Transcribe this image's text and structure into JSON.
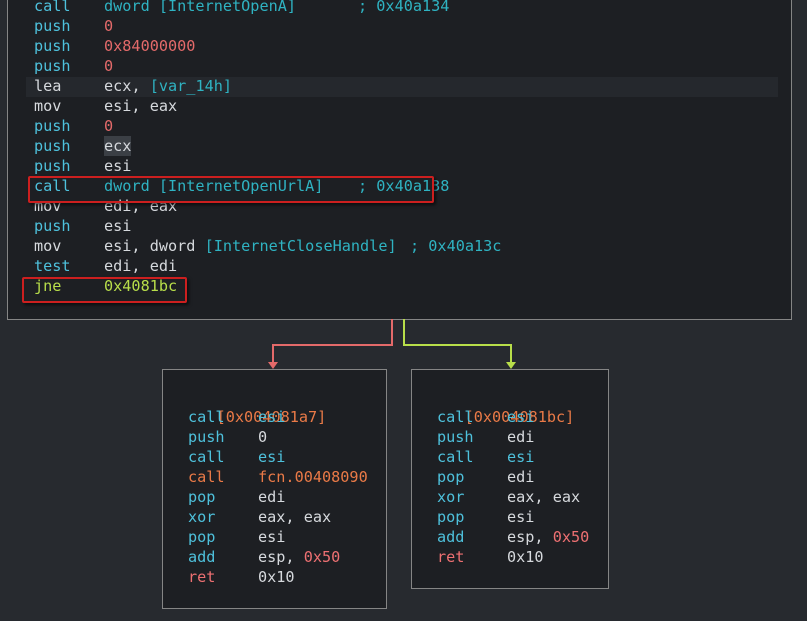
{
  "main_block": {
    "lines": [
      {
        "mnemonic": "call",
        "operand": "dword [InternetOpenA]",
        "comment": "; 0x40a134"
      },
      {
        "mnemonic": "push",
        "operand": "0"
      },
      {
        "mnemonic": "push",
        "operand": "0x84000000"
      },
      {
        "mnemonic": "push",
        "operand": "0"
      },
      {
        "mnemonic": "lea",
        "operand_reg": "ecx",
        "operand_rest": ", ",
        "operand_var": "[var_14h]"
      },
      {
        "mnemonic": "mov",
        "operand": "esi, eax"
      },
      {
        "mnemonic": "push",
        "operand": "0"
      },
      {
        "mnemonic": "push",
        "operand": "ecx"
      },
      {
        "mnemonic": "push",
        "operand": "esi"
      },
      {
        "mnemonic": "call",
        "operand": "dword [InternetOpenUrlA]",
        "comment": "; 0x40a138"
      },
      {
        "mnemonic": "mov",
        "operand": "edi, eax"
      },
      {
        "mnemonic": "push",
        "operand": "esi"
      },
      {
        "mnemonic": "mov",
        "operand_reg": "esi, dword ",
        "operand_var": "[InternetCloseHandle]",
        "comment": "; 0x40a13c"
      },
      {
        "mnemonic": "test",
        "operand": "edi, edi"
      },
      {
        "mnemonic": "jne",
        "operand": "0x4081bc"
      }
    ]
  },
  "left_block": {
    "address": "[0x004081a7]",
    "lines": [
      {
        "mnemonic": "call",
        "operand": "esi"
      },
      {
        "mnemonic": "push",
        "operand": "0"
      },
      {
        "mnemonic": "call",
        "operand": "esi"
      },
      {
        "mnemonic": "call",
        "operand": "fcn.00408090"
      },
      {
        "mnemonic": "pop",
        "operand": "edi"
      },
      {
        "mnemonic": "xor",
        "operand": "eax, eax"
      },
      {
        "mnemonic": "pop",
        "operand": "esi"
      },
      {
        "mnemonic": "add",
        "operand_reg": "esp, ",
        "operand_num": "0x50"
      },
      {
        "mnemonic": "ret",
        "operand": "0x10"
      }
    ]
  },
  "right_block": {
    "address": "[0x004081bc]",
    "lines": [
      {
        "mnemonic": "call",
        "operand": "esi"
      },
      {
        "mnemonic": "push",
        "operand": "edi"
      },
      {
        "mnemonic": "call",
        "operand": "esi"
      },
      {
        "mnemonic": "pop",
        "operand": "edi"
      },
      {
        "mnemonic": "xor",
        "operand": "eax, eax"
      },
      {
        "mnemonic": "pop",
        "operand": "esi"
      },
      {
        "mnemonic": "add",
        "operand_reg": "esp, ",
        "operand_num": "0x50"
      },
      {
        "mnemonic": "ret",
        "operand": "0x10"
      }
    ]
  },
  "colors": {
    "background": "#272a2f",
    "block_bg": "#1d1f23",
    "block_border": "#858585",
    "mnemonic_call_push": "#4ec1dc",
    "mnemonic_mov_lea": "#d6d9dd",
    "mnemonic_jne": "#b8de4a",
    "edge_false": "#e46a6a",
    "edge_true": "#b8de4a",
    "highlight_box": "#cc1f1f"
  }
}
